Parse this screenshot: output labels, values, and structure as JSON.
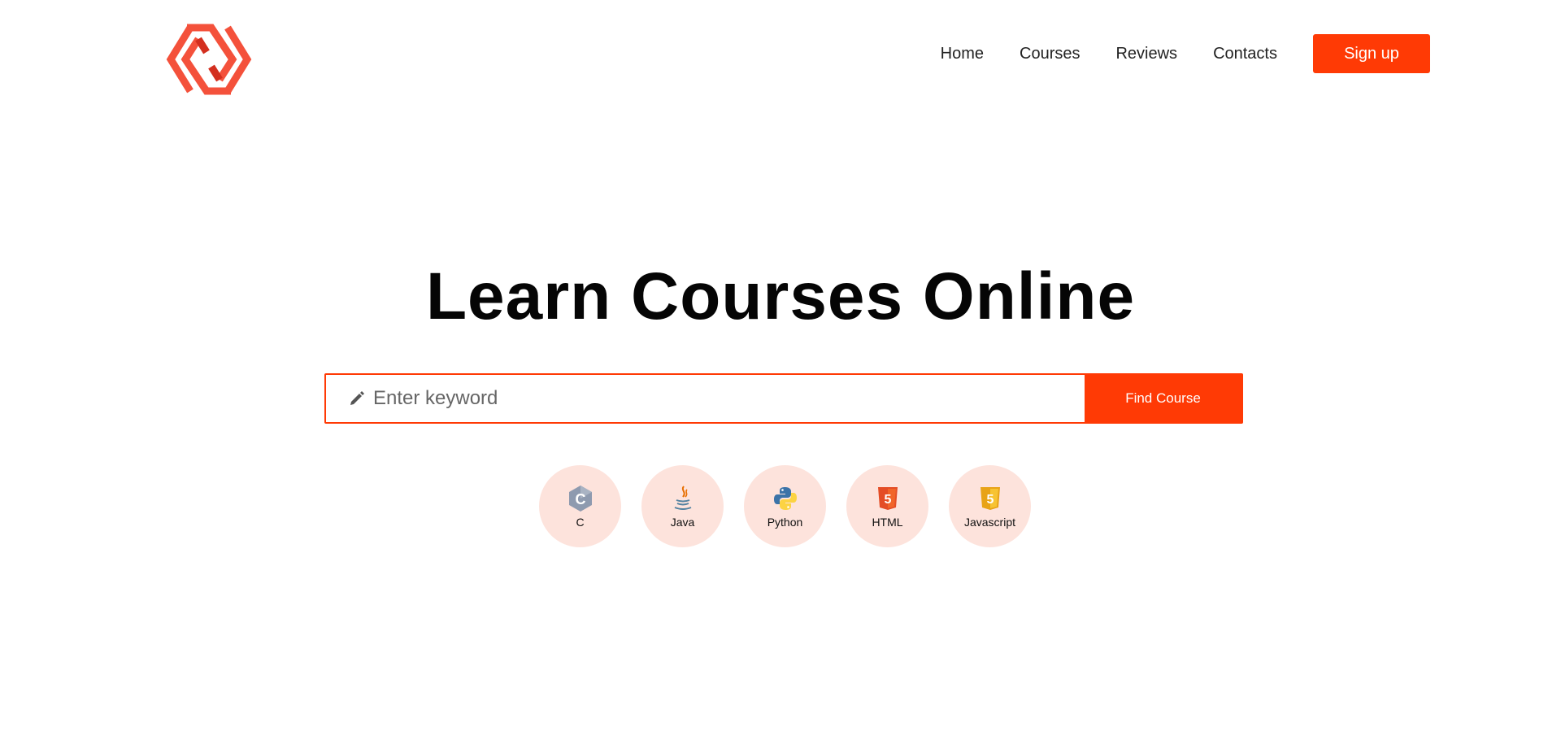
{
  "header": {
    "logo_icon": "hexagon-logo-icon",
    "nav": [
      {
        "label": "Home"
      },
      {
        "label": "Courses"
      },
      {
        "label": "Reviews"
      },
      {
        "label": "Contacts"
      }
    ],
    "signup_label": "Sign up"
  },
  "hero": {
    "title": "Learn Courses Online"
  },
  "search": {
    "icon": "pencil-icon",
    "placeholder": "Enter keyword",
    "value": "",
    "button_label": "Find Course"
  },
  "categories": [
    {
      "label": "C",
      "icon": "c-language-icon"
    },
    {
      "label": "Java",
      "icon": "java-icon"
    },
    {
      "label": "Python",
      "icon": "python-icon"
    },
    {
      "label": "HTML",
      "icon": "html5-icon"
    },
    {
      "label": "Javascript",
      "icon": "javascript-icon"
    }
  ],
  "colors": {
    "accent": "#ff3a05",
    "category_bg": "#fde3dc",
    "logo": "#f4513b"
  }
}
